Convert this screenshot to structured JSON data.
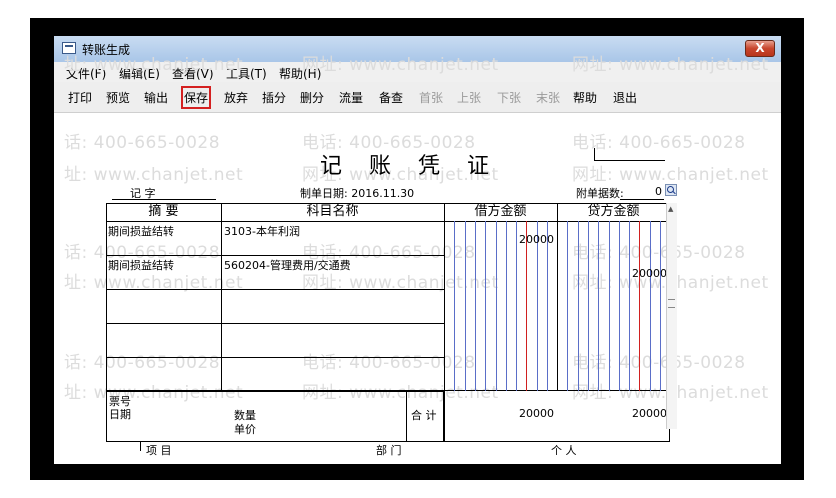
{
  "window": {
    "title": "转账生成",
    "close_label": "X"
  },
  "menu": [
    "文件(F)",
    "编辑(E)",
    "查看(V)",
    "工具(T)",
    "帮助(H)"
  ],
  "toolbar": [
    "打印",
    "预览",
    "输出",
    "保存",
    "放弃",
    "插分",
    "删分",
    "流量",
    "备查",
    "首张",
    "上张",
    "下张",
    "末张",
    "帮助",
    "退出"
  ],
  "toolbar_disabled": [
    "首张",
    "上张",
    "下张",
    "末张"
  ],
  "toolbar_selected": "保存",
  "watermarks": {
    "phone": "电话: 400-665-0028",
    "site": "网址: www.chanjet.net",
    "phone_cut": "话: 400-665-0028",
    "site_cut": "址: www.chanjet.net"
  },
  "voucher": {
    "title": "记 账 凭 证",
    "type_label": "记  字",
    "date_label": "制单日期: 2016.11.30",
    "attachments_label": "附单据数:",
    "attachments_value": "0",
    "columns": [
      "摘 要",
      "科目名称",
      "借方金额",
      "贷方金额"
    ],
    "rows": [
      {
        "summary": "期间损益结转",
        "account": "3103-本年利润",
        "debit": "20000",
        "credit": ""
      },
      {
        "summary": "期间损益结转",
        "account": "560204-管理费用/交通费",
        "debit": "",
        "credit": "20000"
      },
      {
        "summary": "",
        "account": "",
        "debit": "",
        "credit": ""
      },
      {
        "summary": "",
        "account": "",
        "debit": "",
        "credit": ""
      },
      {
        "summary": "",
        "account": "",
        "debit": "",
        "credit": ""
      }
    ],
    "footer": {
      "ticket_label": "票号",
      "date_label": "日期",
      "qty_label": "数量",
      "price_label": "单价",
      "total_label": "合 计",
      "debit_total": "20000",
      "credit_total": "20000"
    },
    "bottom": {
      "item_label": "项 目",
      "dept_label": "部 门",
      "person_label": "个 人"
    }
  },
  "colors": {
    "title_bar": "#b6cfee",
    "selected_outline": "#d42020",
    "grid_line": "#000000",
    "amount_line_blue": "#5a6ec8",
    "amount_line_red": "#d02020"
  }
}
